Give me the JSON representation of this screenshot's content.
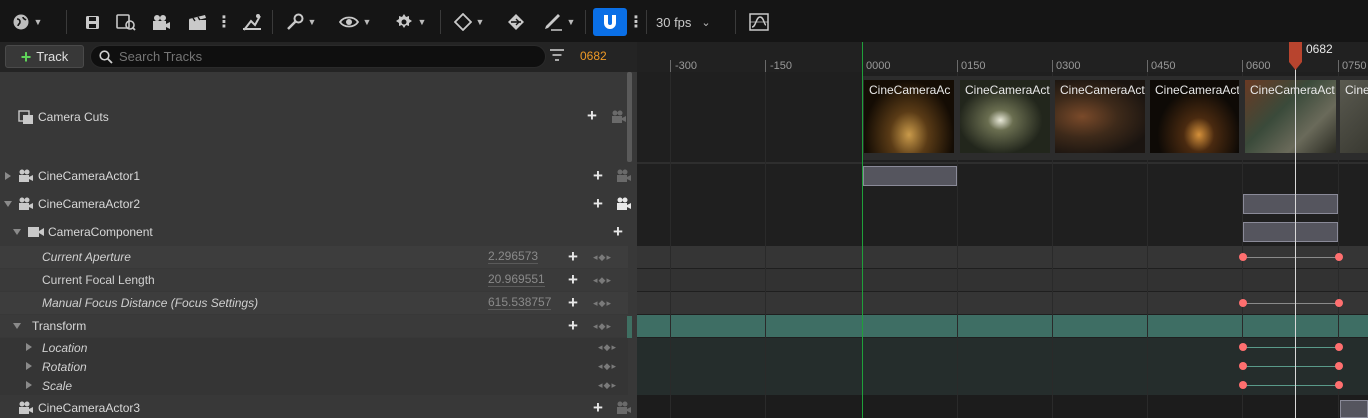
{
  "toolbar": {
    "fps_label": "30 fps",
    "icons": [
      "world-icon",
      "save-icon",
      "save-as-icon",
      "camera-icon",
      "clapper-icon",
      "more-icon",
      "render-icon",
      "wrench-icon",
      "eye-icon",
      "snap-settings-icon",
      "key-icon",
      "auto-key-icon",
      "paint-icon",
      "magnet-icon",
      "curve-editor-icon"
    ]
  },
  "header": {
    "add_track_label": "Track",
    "search_placeholder": "Search Tracks",
    "current_frame": "0682"
  },
  "tracks": {
    "camera_cuts": "Camera Cuts",
    "actor1": "CineCameraActor1",
    "actor2": "CineCameraActor2",
    "camera_component": "CameraComponent",
    "aperture_label": "Current Aperture",
    "aperture_value": "2.296573",
    "focal_label": "Current Focal Length",
    "focal_value": "20.969551",
    "focus_label": "Manual Focus Distance (Focus Settings)",
    "focus_value": "615.538757",
    "transform": "Transform",
    "location": "Location",
    "rotation": "Rotation",
    "scale": "Scale",
    "actor3": "CineCameraActor3"
  },
  "ruler": {
    "ticks": [
      "-300",
      "-150",
      "0000",
      "0150",
      "0300",
      "0450",
      "0600",
      "0750"
    ],
    "playhead": "0682"
  },
  "clips": [
    "CineCameraAc",
    "CineCameraAct",
    "CineCameraAct",
    "CineCameraAct",
    "CineCameraAct",
    "Cine"
  ]
}
